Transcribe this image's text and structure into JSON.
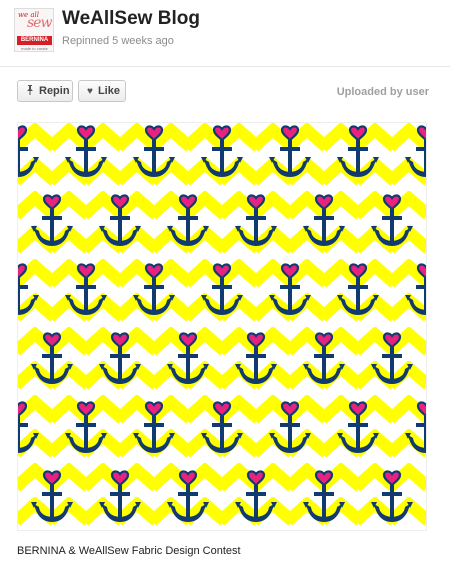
{
  "header": {
    "board_title": "WeAllSew Blog",
    "subline": "Repinned 5 weeks ago",
    "avatar": {
      "text_small": "we all",
      "text_big": "sew",
      "brand": "BERNINA",
      "tagline": "made to create"
    }
  },
  "actions": {
    "repin_label": "Repin",
    "like_label": "Like",
    "uploaded_text": "Uploaded by user"
  },
  "pin": {
    "caption": "BERNINA & WeAllSew Fabric Design Contest",
    "pattern": {
      "chevron_color": "#ffff00",
      "background_color": "#ffffff",
      "anchor_color": "#103a70",
      "heart_color": "#e8237f"
    }
  },
  "icons": {
    "repin": "pushpin-icon",
    "like": "heart-icon"
  }
}
